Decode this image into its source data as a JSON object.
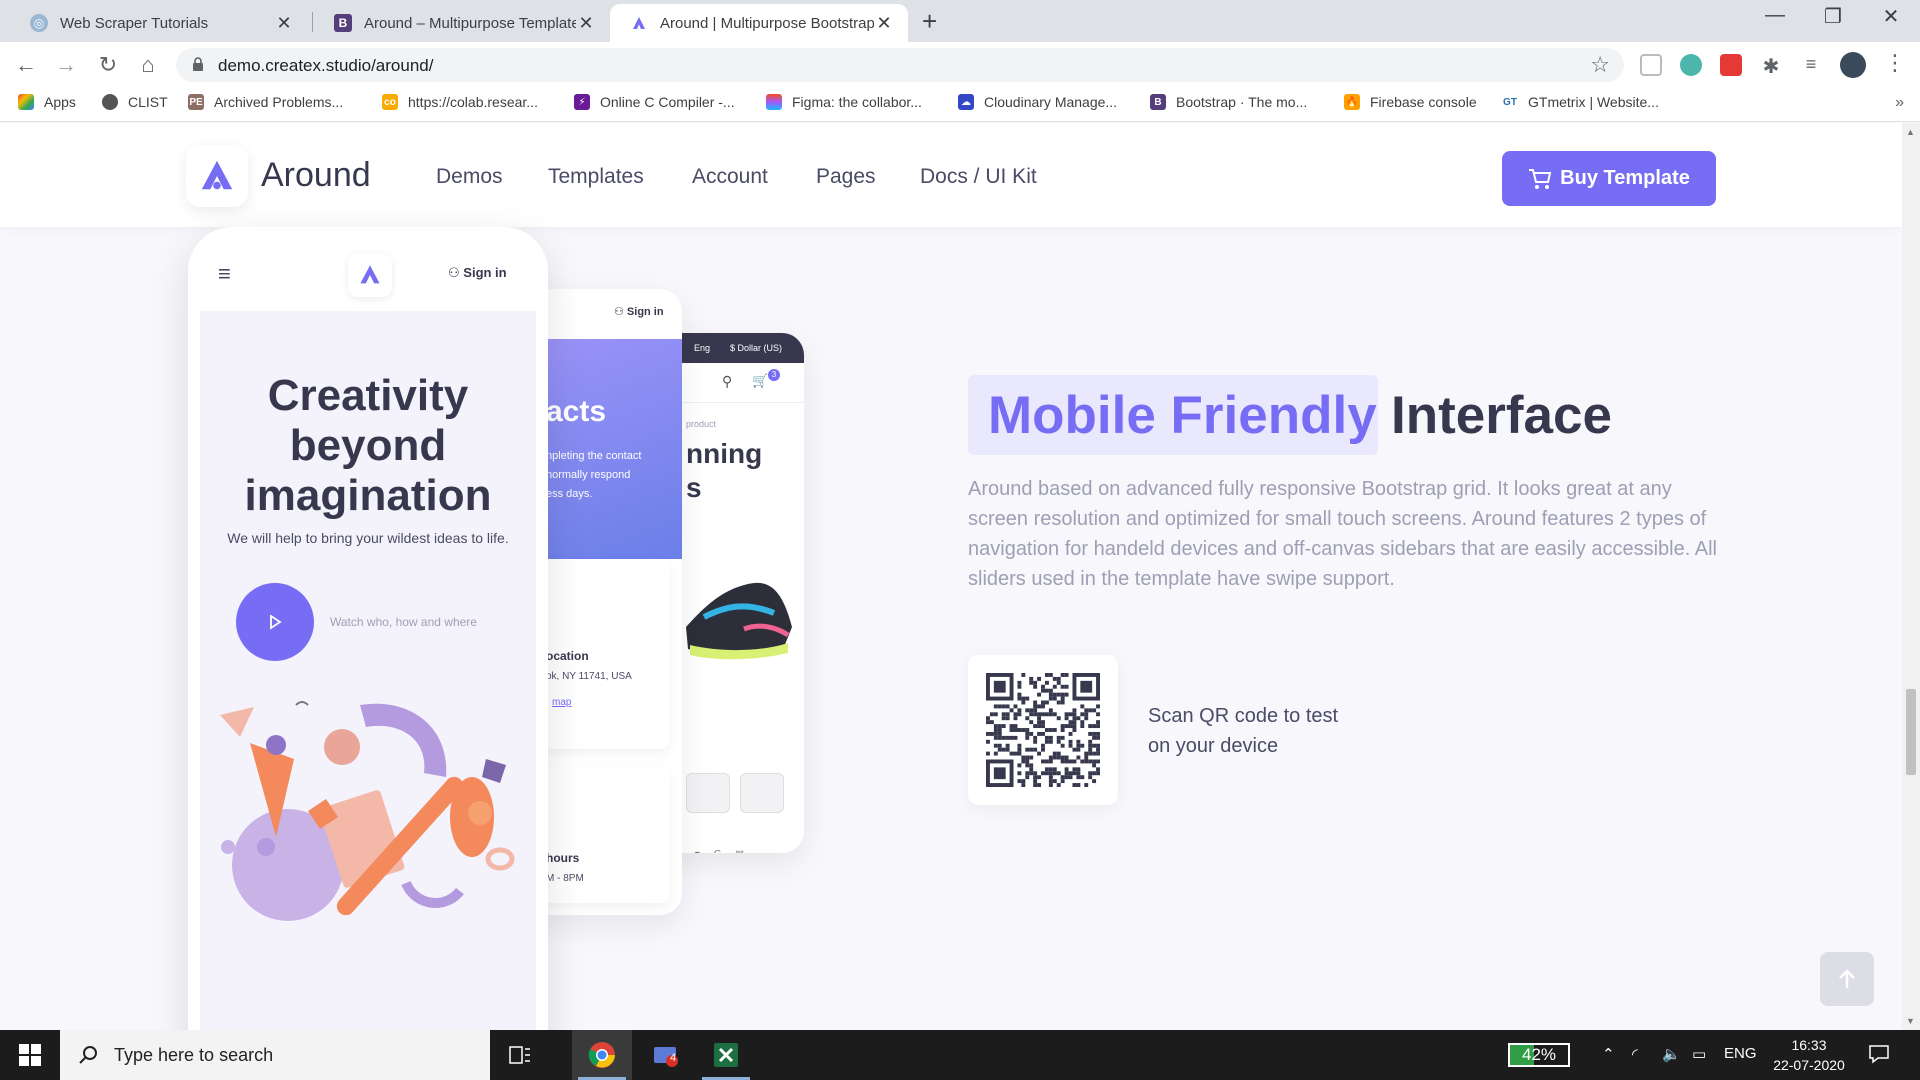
{
  "browser": {
    "tabs": [
      {
        "title": "Web Scraper Tutorials",
        "active": false
      },
      {
        "title": "Around – Multipurpose Template",
        "active": false
      },
      {
        "title": "Around | Multipurpose Bootstrap",
        "active": true
      }
    ],
    "new_tab": "+",
    "url": "demo.createx.studio/around/",
    "bookmarks": [
      "Apps",
      "CLIST",
      "Archived Problems...",
      "https://colab.resear...",
      "Online C Compiler -...",
      "Figma: the collabor...",
      "Cloudinary Manage...",
      "Bootstrap · The mo...",
      "Firebase console",
      "GTmetrix | Website..."
    ],
    "bookmarks_more": "»"
  },
  "site": {
    "logo_text": "Around",
    "nav": [
      "Demos",
      "Templates",
      "Account",
      "Pages",
      "Docs / UI Kit"
    ],
    "buy_button": "Buy Template"
  },
  "phone_main": {
    "sign_in": "Sign in",
    "title_line1": "Creativity",
    "title_line2": "beyond",
    "title_line3": "imagination",
    "subtitle": "We will help to bring your wildest ideas to life.",
    "watch": "Watch who, how and where"
  },
  "phone_contacts": {
    "sign_in": "Sign in",
    "heading": "acts",
    "text1": "npleting the contact",
    "text2": "normally respond",
    "text3": "ess days.",
    "location_title": "ocation",
    "location_addr": "ok, NY 11741, USA",
    "map_link": "map",
    "hours_title": "hours",
    "hours_value": "M - 8PM"
  },
  "phone_shop": {
    "lang": "Eng",
    "currency": "$ Dollar (US)",
    "cart_count": "3",
    "breadcrumb": "product",
    "heading1": "nning",
    "heading2": "s"
  },
  "feature": {
    "title_highlight": "Mobile Friendly",
    "title_rest": "Interface",
    "description": "Around based on advanced fully responsive Bootstrap grid. It looks great at any screen resolution and optimized for small touch screens. Around features 2 types of navigation for handeld devices and off-canvas sidebars that are easily accessible. All sliders used in the template have swipe support.",
    "qr_line1": "Scan QR code to test",
    "qr_line2": "on your device"
  },
  "taskbar": {
    "search_placeholder": "Type here to search",
    "battery": "42%",
    "battery_level": 0.42,
    "lang": "ENG",
    "time": "16:33",
    "date": "22-07-2020",
    "mail_badge": "4"
  },
  "colors": {
    "accent": "#766df4",
    "heading": "#37384e",
    "muted": "#9e9fb4"
  }
}
